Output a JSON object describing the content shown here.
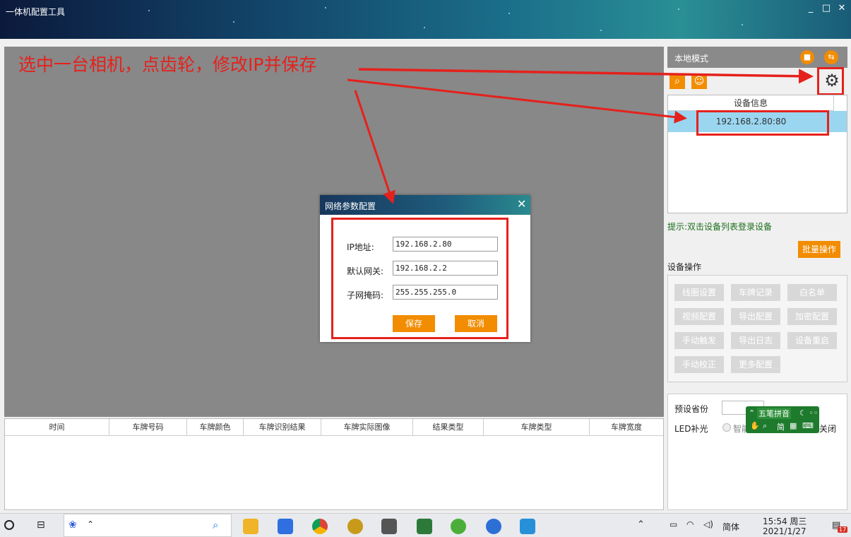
{
  "window": {
    "title": "一体机配置工具",
    "min": "_",
    "max": "□",
    "close": "✕"
  },
  "annotation": "选中一台相机，点齿轮，修改IP并保存",
  "results_table": {
    "columns": [
      "时间",
      "车牌号码",
      "车牌颜色",
      "车牌识别结果",
      "车牌实际图像",
      "结果类型",
      "车牌类型",
      "车牌宽度"
    ]
  },
  "right_panel": {
    "mode_label": "本地模式",
    "device_list_header": "设备信息",
    "devices": [
      "192.168.2.80:80"
    ],
    "hint": "提示:双击设备列表登录设备",
    "batch_button": "批量操作",
    "ops_label": "设备操作",
    "ops": [
      "线圈设置",
      "车牌记录",
      "白名单",
      "视频配置",
      "导出配置",
      "加密配置",
      "手动触发",
      "导出日志",
      "设备重启",
      "手动校正",
      "更多配置"
    ],
    "preset_province_label": "预设省份",
    "led_label": "LED补光",
    "led_option_smart": "智能",
    "led_option_off": "关闭"
  },
  "ime": {
    "name": "五笔拼音",
    "mode": "简"
  },
  "dialog": {
    "title": "网络参数配置",
    "close": "✕",
    "fields": [
      {
        "label": "IP地址:",
        "value": "192.168.2.80"
      },
      {
        "label": "默认网关:",
        "value": "192.168.2.2"
      },
      {
        "label": "子网掩码:",
        "value": "255.255.255.0"
      }
    ],
    "save": "保存",
    "cancel": "取消"
  },
  "taskbar": {
    "time": "15:54 周三",
    "date": "2021/1/27",
    "lang": "简体",
    "notification_count": "17"
  },
  "colors": {
    "accent": "#f28c00",
    "annotation": "#e5211c",
    "selected_row": "#9ad6f0"
  }
}
